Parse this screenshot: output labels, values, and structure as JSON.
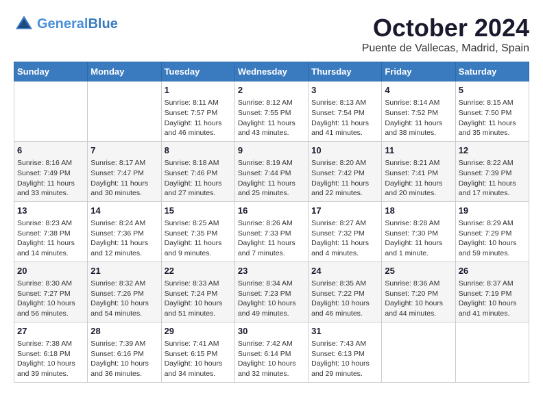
{
  "header": {
    "logo_line1": "General",
    "logo_line2": "Blue",
    "month": "October 2024",
    "location": "Puente de Vallecas, Madrid, Spain"
  },
  "days_of_week": [
    "Sunday",
    "Monday",
    "Tuesday",
    "Wednesday",
    "Thursday",
    "Friday",
    "Saturday"
  ],
  "weeks": [
    [
      {
        "day": "",
        "detail": ""
      },
      {
        "day": "",
        "detail": ""
      },
      {
        "day": "1",
        "detail": "Sunrise: 8:11 AM\nSunset: 7:57 PM\nDaylight: 11 hours and 46 minutes."
      },
      {
        "day": "2",
        "detail": "Sunrise: 8:12 AM\nSunset: 7:55 PM\nDaylight: 11 hours and 43 minutes."
      },
      {
        "day": "3",
        "detail": "Sunrise: 8:13 AM\nSunset: 7:54 PM\nDaylight: 11 hours and 41 minutes."
      },
      {
        "day": "4",
        "detail": "Sunrise: 8:14 AM\nSunset: 7:52 PM\nDaylight: 11 hours and 38 minutes."
      },
      {
        "day": "5",
        "detail": "Sunrise: 8:15 AM\nSunset: 7:50 PM\nDaylight: 11 hours and 35 minutes."
      }
    ],
    [
      {
        "day": "6",
        "detail": "Sunrise: 8:16 AM\nSunset: 7:49 PM\nDaylight: 11 hours and 33 minutes."
      },
      {
        "day": "7",
        "detail": "Sunrise: 8:17 AM\nSunset: 7:47 PM\nDaylight: 11 hours and 30 minutes."
      },
      {
        "day": "8",
        "detail": "Sunrise: 8:18 AM\nSunset: 7:46 PM\nDaylight: 11 hours and 27 minutes."
      },
      {
        "day": "9",
        "detail": "Sunrise: 8:19 AM\nSunset: 7:44 PM\nDaylight: 11 hours and 25 minutes."
      },
      {
        "day": "10",
        "detail": "Sunrise: 8:20 AM\nSunset: 7:42 PM\nDaylight: 11 hours and 22 minutes."
      },
      {
        "day": "11",
        "detail": "Sunrise: 8:21 AM\nSunset: 7:41 PM\nDaylight: 11 hours and 20 minutes."
      },
      {
        "day": "12",
        "detail": "Sunrise: 8:22 AM\nSunset: 7:39 PM\nDaylight: 11 hours and 17 minutes."
      }
    ],
    [
      {
        "day": "13",
        "detail": "Sunrise: 8:23 AM\nSunset: 7:38 PM\nDaylight: 11 hours and 14 minutes."
      },
      {
        "day": "14",
        "detail": "Sunrise: 8:24 AM\nSunset: 7:36 PM\nDaylight: 11 hours and 12 minutes."
      },
      {
        "day": "15",
        "detail": "Sunrise: 8:25 AM\nSunset: 7:35 PM\nDaylight: 11 hours and 9 minutes."
      },
      {
        "day": "16",
        "detail": "Sunrise: 8:26 AM\nSunset: 7:33 PM\nDaylight: 11 hours and 7 minutes."
      },
      {
        "day": "17",
        "detail": "Sunrise: 8:27 AM\nSunset: 7:32 PM\nDaylight: 11 hours and 4 minutes."
      },
      {
        "day": "18",
        "detail": "Sunrise: 8:28 AM\nSunset: 7:30 PM\nDaylight: 11 hours and 1 minute."
      },
      {
        "day": "19",
        "detail": "Sunrise: 8:29 AM\nSunset: 7:29 PM\nDaylight: 10 hours and 59 minutes."
      }
    ],
    [
      {
        "day": "20",
        "detail": "Sunrise: 8:30 AM\nSunset: 7:27 PM\nDaylight: 10 hours and 56 minutes."
      },
      {
        "day": "21",
        "detail": "Sunrise: 8:32 AM\nSunset: 7:26 PM\nDaylight: 10 hours and 54 minutes."
      },
      {
        "day": "22",
        "detail": "Sunrise: 8:33 AM\nSunset: 7:24 PM\nDaylight: 10 hours and 51 minutes."
      },
      {
        "day": "23",
        "detail": "Sunrise: 8:34 AM\nSunset: 7:23 PM\nDaylight: 10 hours and 49 minutes."
      },
      {
        "day": "24",
        "detail": "Sunrise: 8:35 AM\nSunset: 7:22 PM\nDaylight: 10 hours and 46 minutes."
      },
      {
        "day": "25",
        "detail": "Sunrise: 8:36 AM\nSunset: 7:20 PM\nDaylight: 10 hours and 44 minutes."
      },
      {
        "day": "26",
        "detail": "Sunrise: 8:37 AM\nSunset: 7:19 PM\nDaylight: 10 hours and 41 minutes."
      }
    ],
    [
      {
        "day": "27",
        "detail": "Sunrise: 7:38 AM\nSunset: 6:18 PM\nDaylight: 10 hours and 39 minutes."
      },
      {
        "day": "28",
        "detail": "Sunrise: 7:39 AM\nSunset: 6:16 PM\nDaylight: 10 hours and 36 minutes."
      },
      {
        "day": "29",
        "detail": "Sunrise: 7:41 AM\nSunset: 6:15 PM\nDaylight: 10 hours and 34 minutes."
      },
      {
        "day": "30",
        "detail": "Sunrise: 7:42 AM\nSunset: 6:14 PM\nDaylight: 10 hours and 32 minutes."
      },
      {
        "day": "31",
        "detail": "Sunrise: 7:43 AM\nSunset: 6:13 PM\nDaylight: 10 hours and 29 minutes."
      },
      {
        "day": "",
        "detail": ""
      },
      {
        "day": "",
        "detail": ""
      }
    ]
  ]
}
